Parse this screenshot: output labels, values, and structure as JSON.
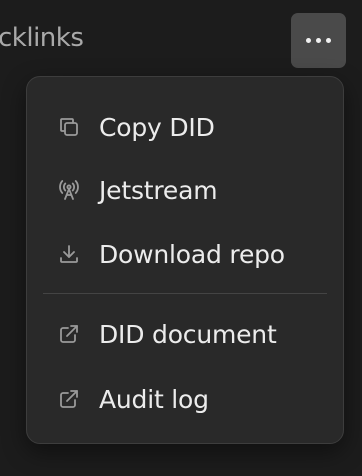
{
  "header": {
    "title": "cklinks"
  },
  "menu": {
    "items": [
      {
        "label": "Copy DID",
        "icon": "copy-icon"
      },
      {
        "label": "Jetstream",
        "icon": "broadcast-icon"
      },
      {
        "label": "Download repo",
        "icon": "download-icon"
      },
      {
        "label": "DID document",
        "icon": "external-link-icon"
      },
      {
        "label": "Audit log",
        "icon": "external-link-icon"
      }
    ]
  },
  "colors": {
    "background": "#1c1c1c",
    "menu_bg": "#292929",
    "button_bg": "#4a4a4a",
    "text": "#ececec",
    "icon": "#9a9a9a"
  }
}
